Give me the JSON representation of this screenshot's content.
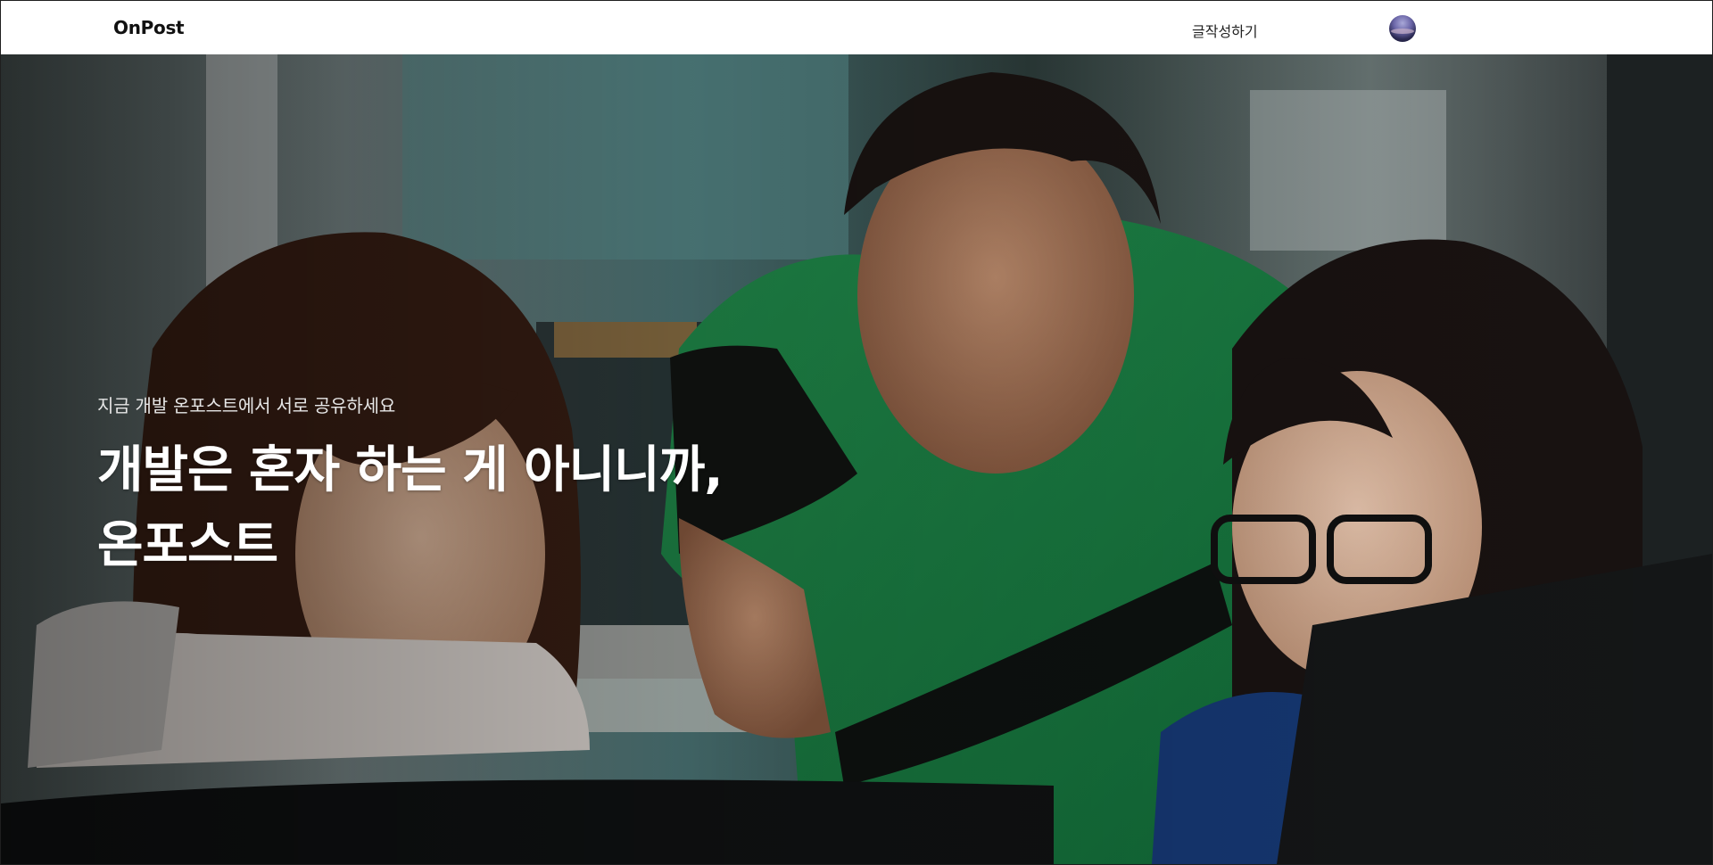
{
  "header": {
    "logo": "OnPost",
    "write_label": "글작성하기"
  },
  "hero": {
    "subtitle": "지금 개발 온포스트에서 서로 공유하세요",
    "title_line1": "개발은 혼자 하는 게 아니니까,",
    "title_line2": "온포스트",
    "image_description_icon": "office-team-photo"
  },
  "colors": {
    "header_bg": "#ffffff",
    "text_dark": "#111111",
    "hero_text": "#ffffff",
    "shirt_green": "#1f8a4c"
  }
}
